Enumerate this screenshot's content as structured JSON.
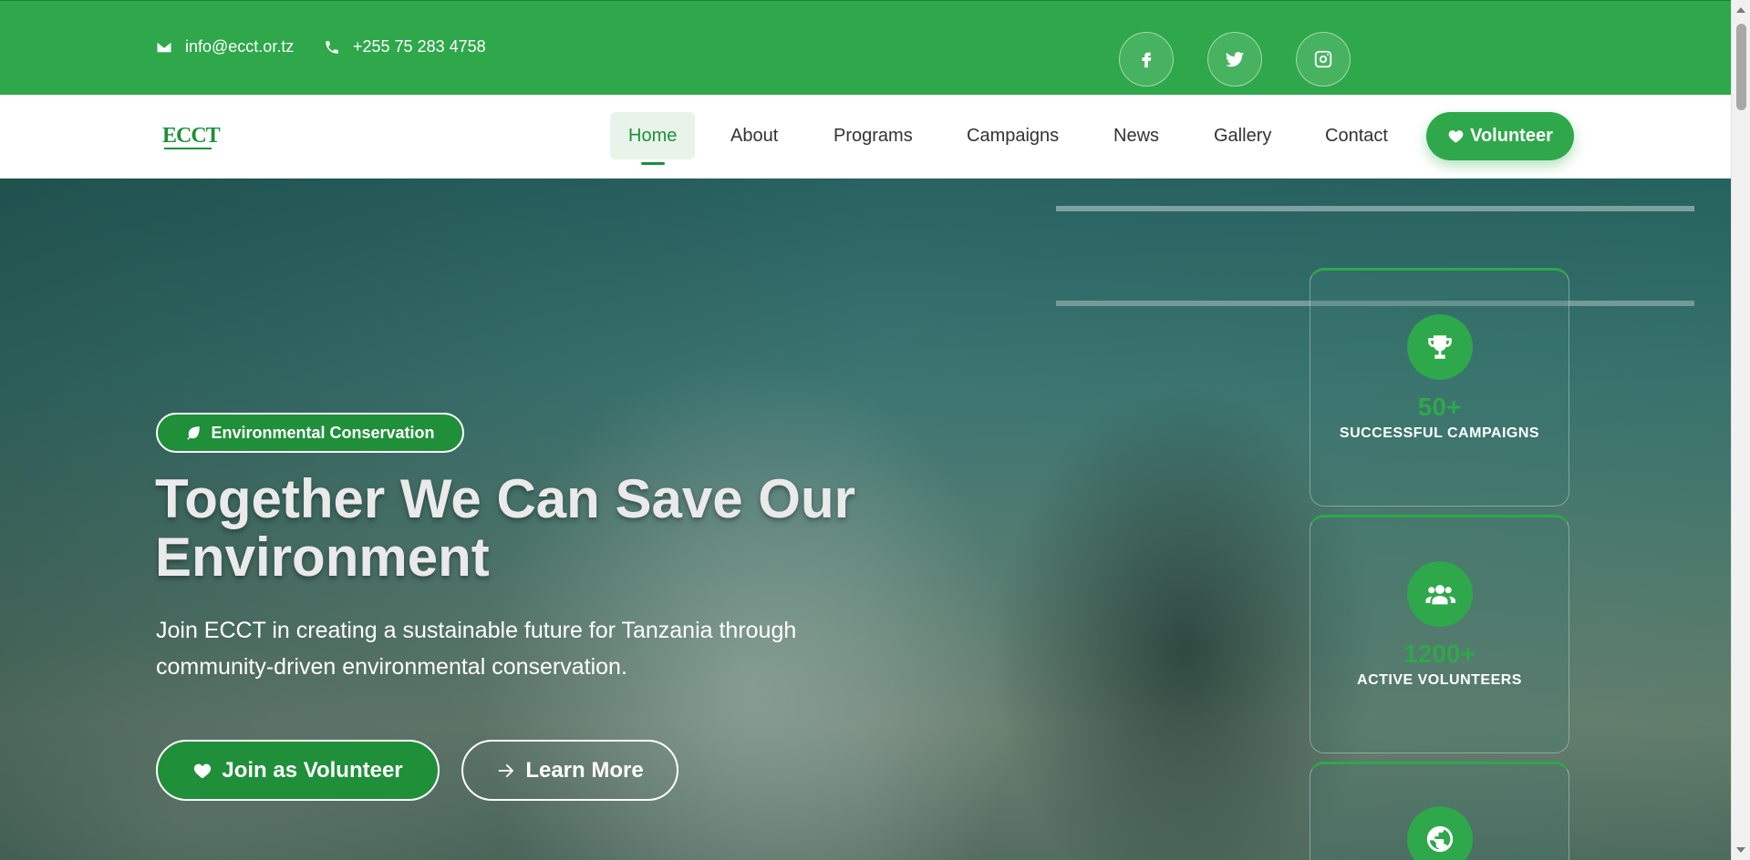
{
  "topbar": {
    "email": "info@ecct.or.tz",
    "phone": "+255 75 283 4758",
    "social": [
      "facebook-icon",
      "twitter-icon",
      "instagram-icon"
    ]
  },
  "nav": {
    "logo": "ECCT",
    "items": [
      {
        "label": "Home",
        "active": true
      },
      {
        "label": "About"
      },
      {
        "label": "Programs"
      },
      {
        "label": "Campaigns"
      },
      {
        "label": "News"
      },
      {
        "label": "Gallery"
      },
      {
        "label": "Contact"
      }
    ],
    "cta_label": "Volunteer"
  },
  "hero": {
    "badge": "Environmental Conservation",
    "headline": "Together We Can Save Our Environment",
    "subtext": "Join ECCT in creating a sustainable future for Tanzania through community-driven environmental conservation.",
    "primary_button": "Join as Volunteer",
    "secondary_button": "Learn More"
  },
  "stats": [
    {
      "icon": "trophy-icon",
      "value": "50+",
      "label": "SUCCESSFUL CAMPAIGNS"
    },
    {
      "icon": "users-icon",
      "value": "1200+",
      "label": "ACTIVE VOLUNTEERS"
    },
    {
      "icon": "globe-icon",
      "value": "",
      "label": ""
    }
  ],
  "colors": {
    "primary": "#2ea84a",
    "primary_dark": "#1f8f3a"
  }
}
